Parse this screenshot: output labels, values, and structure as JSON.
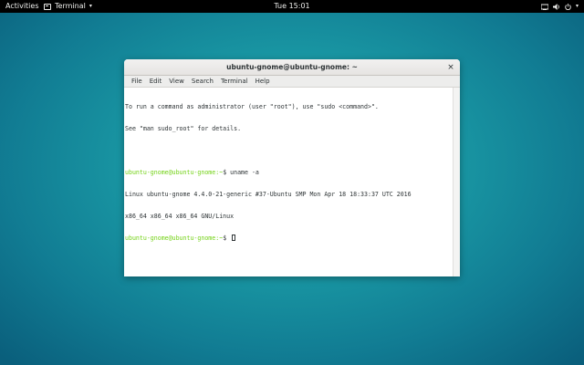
{
  "topbar": {
    "activities": "Activities",
    "app_name": "Terminal",
    "caret": "▾",
    "clock": "Tue 15:01",
    "status_caret": "▾",
    "icons": [
      "network-icon",
      "volume-icon",
      "power-icon"
    ]
  },
  "window": {
    "title": "ubuntu-gnome@ubuntu-gnome: ~",
    "close_glyph": "×",
    "menu": [
      "File",
      "Edit",
      "View",
      "Search",
      "Terminal",
      "Help"
    ]
  },
  "terminal": {
    "lines": [
      {
        "text": "To run a command as administrator (user \"root\"), use \"sudo <command>\"."
      },
      {
        "text": "See \"man sudo_root\" for details."
      },
      {
        "text": ""
      },
      {
        "prompt": "ubuntu-gnome@ubuntu-gnome:~",
        "prompt_suffix": "$ ",
        "text": "uname -a"
      },
      {
        "text": "Linux ubuntu-gnome 4.4.0-21-generic #37-Ubuntu SMP Mon Apr 18 18:33:37 UTC 2016"
      },
      {
        "text": "x86_64 x86_64 x86_64 GNU/Linux"
      },
      {
        "prompt": "ubuntu-gnome@ubuntu-gnome:~",
        "prompt_suffix": "$ ",
        "text": "",
        "cursor": true
      }
    ]
  },
  "colors": {
    "prompt": "#73d216",
    "topbar": "#000000",
    "desktop": "#1a9aa5"
  }
}
